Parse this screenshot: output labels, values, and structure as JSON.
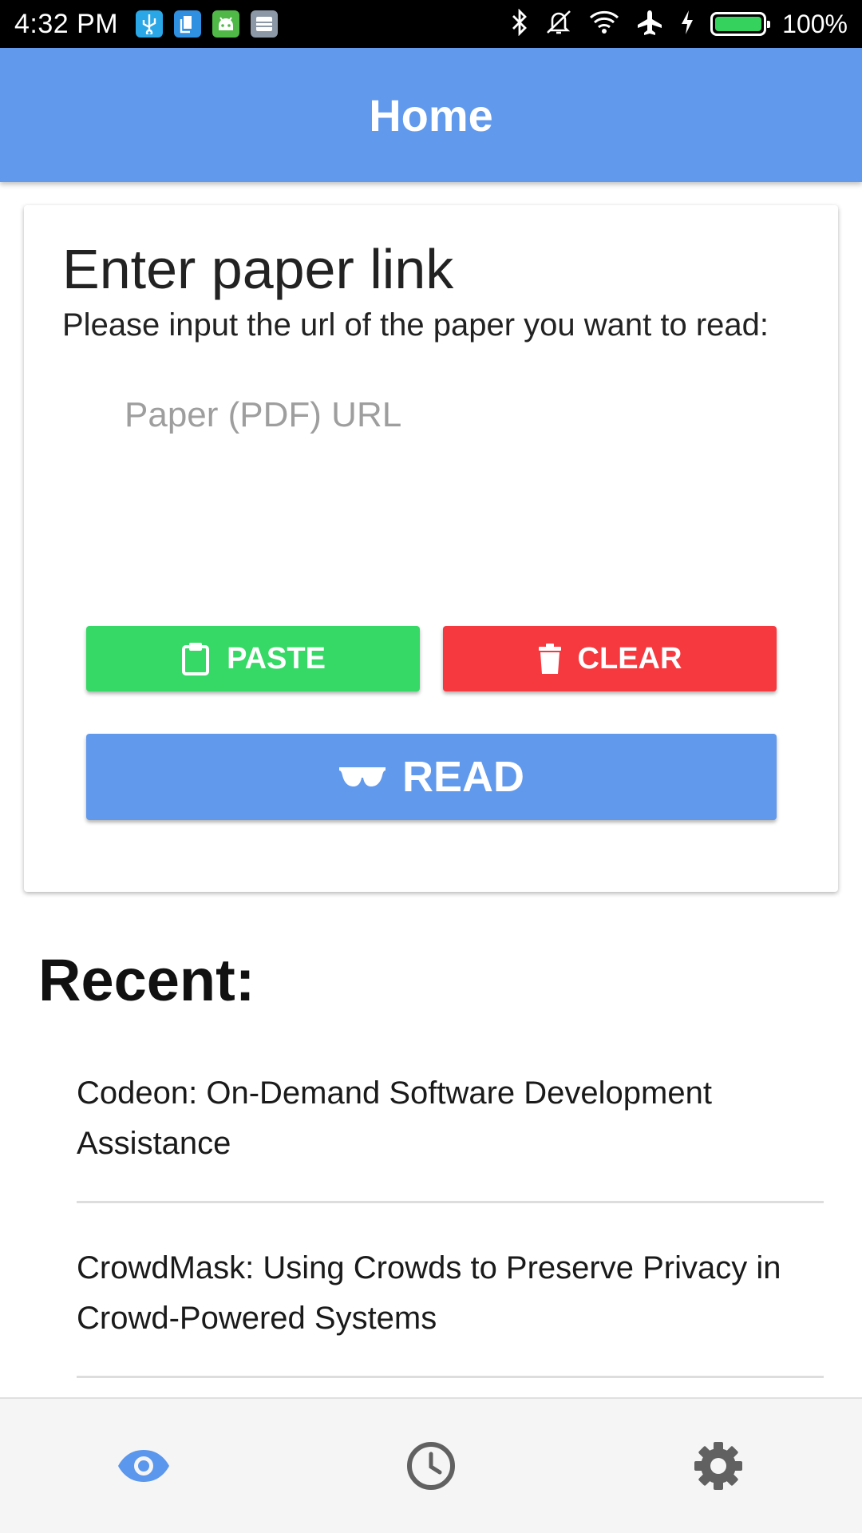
{
  "status_bar": {
    "time": "4:32 PM",
    "battery_percent_label": "100%",
    "battery_level": 1.0,
    "notification_icons": [
      "usb-icon",
      "file-transfer-icon",
      "android-debug-icon",
      "storage-icon"
    ],
    "system_icons": [
      "bluetooth-icon",
      "vibrate-off-icon",
      "wifi-icon",
      "airplane-icon",
      "charging-icon",
      "battery-icon"
    ]
  },
  "app_bar": {
    "title": "Home"
  },
  "card": {
    "title": "Enter paper link",
    "subtitle": "Please input the url of the paper you want to read:",
    "url_input": {
      "placeholder": "Paper (PDF) URL",
      "value": ""
    },
    "paste_label": "PASTE",
    "clear_label": "CLEAR",
    "read_label": "READ"
  },
  "recent": {
    "title": "Recent:",
    "items": [
      "Codeon: On-Demand Software Development Assistance",
      "CrowdMask: Using Crowds to Preserve Privacy in Crowd-Powered Systems"
    ]
  },
  "bottom_nav": {
    "items": [
      "eye-icon",
      "clock-icon",
      "gear-icon"
    ],
    "active": "eye-icon"
  },
  "colors": {
    "primary": "#6199ed",
    "paste_green": "#36d965",
    "clear_red": "#f5393f",
    "nav_active": "#5b97ec",
    "nav_inactive": "#616161",
    "notif_usb": "#2aa7e6",
    "notif_file": "#2f8fe0",
    "notif_android": "#4fb847",
    "notif_storage": "#8c98a6",
    "battery_green": "#35d35e"
  }
}
